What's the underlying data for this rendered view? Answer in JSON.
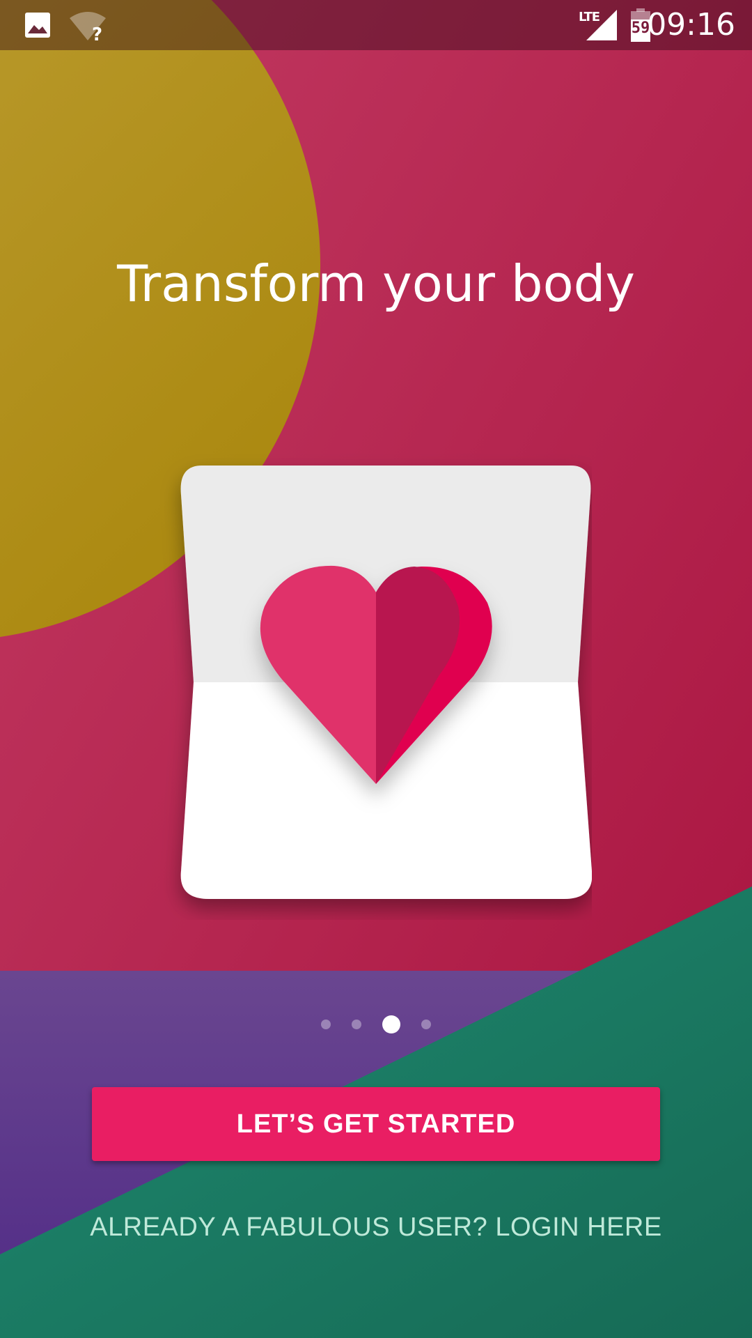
{
  "status_bar": {
    "time": "09:16",
    "network_label": "LTE",
    "battery_level": "59",
    "icons": [
      "image-notification-icon",
      "wifi-unknown-icon",
      "signal-lte-icon",
      "battery-icon"
    ]
  },
  "onboarding": {
    "title": "Transform your body",
    "illustration": "heart-card-icon",
    "page_indicator": {
      "total": 4,
      "current": 3
    }
  },
  "actions": {
    "primary_label": "LET’S GET STARTED",
    "login_label": "ALREADY A FABULOUS USER? LOGIN HERE"
  },
  "colors": {
    "background_magenta": "#b8224a",
    "mustard_circle": "#b8981f",
    "purple": "#5b3a8a",
    "teal": "#1e7d66",
    "cta": "#e91e63",
    "heart_light": "#e0306a",
    "heart_dark": "#b8134f",
    "card_top": "#ebebeb",
    "card_bottom": "#ffffff"
  }
}
